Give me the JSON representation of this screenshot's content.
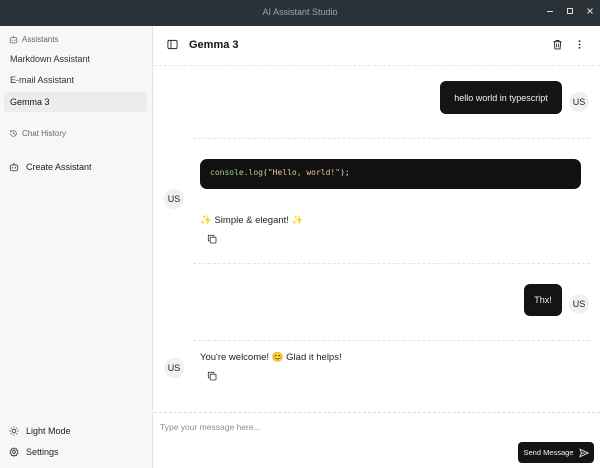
{
  "window": {
    "title": "AI Assistant Studio"
  },
  "sidebar": {
    "assistants_header": "Assistants",
    "assistants": [
      {
        "label": "Markdown Assistant",
        "active": false
      },
      {
        "label": "E-mail Assistant",
        "active": false
      },
      {
        "label": "Gemma 3",
        "active": true
      }
    ],
    "chat_history_header": "Chat History",
    "create_label": "Create Assistant",
    "light_mode_label": "Light Mode",
    "settings_label": "Settings"
  },
  "header": {
    "title": "Gemma 3"
  },
  "messages": [
    {
      "role": "user",
      "avatar": "US",
      "text": "hello world in typescript"
    },
    {
      "role": "assistant",
      "avatar": "US",
      "code": {
        "fn": "console.log",
        "open": "(",
        "str": "\"Hello, world!\"",
        "close": ");"
      },
      "text": "✨ Simple & elegant! ✨"
    },
    {
      "role": "user",
      "avatar": "US",
      "text": "Thx!"
    },
    {
      "role": "assistant",
      "avatar": "US",
      "text": "You're welcome! 😊 Glad it helps!"
    }
  ],
  "composer": {
    "placeholder": "Type your message here...",
    "send_label": "Send Message"
  },
  "icons": {
    "sidebar_toggle": "sidebar-toggle-icon",
    "trash": "trash-icon",
    "more": "more-vertical-icon",
    "copy": "copy-icon",
    "send": "send-icon"
  }
}
